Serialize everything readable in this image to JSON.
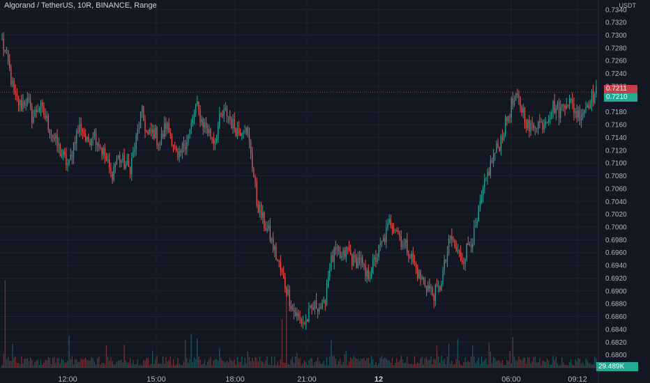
{
  "chart": {
    "title": "Algorand / TetherUS, 10R, BINANCE, Range",
    "unit_top": "USDT",
    "last_price_tag": "0.7211",
    "current_price_tag": "0.7210",
    "volume_tag": "29.489K"
  },
  "colors": {
    "background": "#131722",
    "up": "#26a69a",
    "down": "#ef5350",
    "grid": "#1e2230",
    "axis_text": "#b2b5be"
  },
  "chart_data": {
    "type": "candlestick",
    "symbol": "ALGO/USDT",
    "interval": "10R (Range)",
    "exchange": "BINANCE",
    "x_ticks": [
      "12:00",
      "15:00",
      "18:00",
      "21:00",
      "12",
      "06:00",
      "09:12"
    ],
    "y_ticks": [
      "0.7340",
      "0.7320",
      "0.7300",
      "0.7280",
      "0.7260",
      "0.7240",
      "0.7220",
      "0.7200",
      "0.7180",
      "0.7160",
      "0.7140",
      "0.7120",
      "0.7100",
      "0.7080",
      "0.7060",
      "0.7040",
      "0.7020",
      "0.7000",
      "0.6980",
      "0.6960",
      "0.6940",
      "0.6920",
      "0.6900",
      "0.6880",
      "0.6860",
      "0.6840",
      "0.6820",
      "0.6800"
    ],
    "ylim": [
      0.678,
      0.7355
    ],
    "last_price": 0.7211,
    "current_price": 0.721,
    "last_volume": "29.489K",
    "close_path": [
      0.729,
      0.7255,
      0.7205,
      0.719,
      0.72,
      0.717,
      0.719,
      0.7175,
      0.715,
      0.713,
      0.711,
      0.7095,
      0.714,
      0.716,
      0.713,
      0.715,
      0.713,
      0.711,
      0.708,
      0.711,
      0.71,
      0.709,
      0.713,
      0.718,
      0.714,
      0.715,
      0.713,
      0.716,
      0.714,
      0.71,
      0.713,
      0.715,
      0.719,
      0.7165,
      0.715,
      0.7135,
      0.717,
      0.718,
      0.716,
      0.715,
      0.716,
      0.712,
      0.704,
      0.701,
      0.699,
      0.696,
      0.693,
      0.69,
      0.687,
      0.6855,
      0.685,
      0.687,
      0.688,
      0.687,
      0.694,
      0.696,
      0.695,
      0.6965,
      0.6945,
      0.695,
      0.692,
      0.6935,
      0.696,
      0.698,
      0.701,
      0.7,
      0.6975,
      0.6965,
      0.694,
      0.692,
      0.691,
      0.6895,
      0.69,
      0.694,
      0.6985,
      0.696,
      0.695,
      0.6975,
      0.699,
      0.704,
      0.708,
      0.711,
      0.713,
      0.716,
      0.719,
      0.72,
      0.718,
      0.715,
      0.7165,
      0.716,
      0.7175,
      0.719,
      0.718,
      0.72,
      0.719,
      0.7175,
      0.7185,
      0.72,
      0.721
    ]
  }
}
